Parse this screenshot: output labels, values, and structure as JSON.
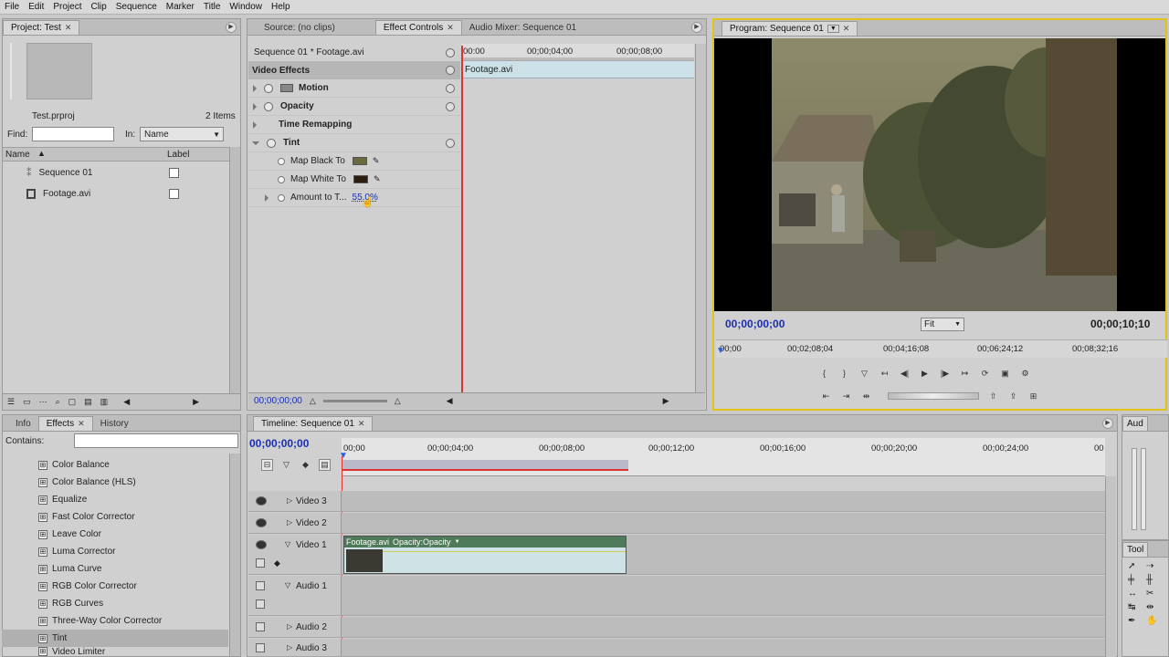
{
  "menu": [
    "File",
    "Edit",
    "Project",
    "Clip",
    "Sequence",
    "Marker",
    "Title",
    "Window",
    "Help"
  ],
  "project": {
    "tab": "Project: Test",
    "file": "Test.prproj",
    "items": "2 Items",
    "find_label": "Find:",
    "in_label": "In:",
    "in_value": "Name",
    "col_name": "Name",
    "col_label": "Label",
    "rows": [
      "Sequence 01",
      "Footage.avi"
    ]
  },
  "ec": {
    "tabs": [
      "Source: (no clips)",
      "Effect Controls",
      "Audio Mixer: Sequence 01"
    ],
    "seq": "Sequence 01 * Footage.avi",
    "video_effects": "Video Effects",
    "motion": "Motion",
    "opacity": "Opacity",
    "time_remap": "Time Remapping",
    "tint": "Tint",
    "map_black": "Map Black To",
    "map_white": "Map White To",
    "amount": "Amount to T...",
    "amount_val": "55.0%",
    "ruler": [
      "00:00",
      "00;00;04;00",
      "00;00;08;00"
    ],
    "clip": "Footage.avi",
    "timecode": "00;00;00;00",
    "black_color": "#6b6a3e",
    "white_color": "#2a1e10"
  },
  "program": {
    "tab": "Program: Sequence 01",
    "tc_left": "00;00;00;00",
    "fit": "Fit",
    "tc_right": "00;00;10;10",
    "ruler": [
      "00;00",
      "00;02;08;04",
      "00;04;16;08",
      "00;06;24;12",
      "00;08;32;16"
    ]
  },
  "effects": {
    "tabs": [
      "Info",
      "Effects",
      "History"
    ],
    "contains": "Contains:",
    "items": [
      "Color Balance",
      "Color Balance (HLS)",
      "Equalize",
      "Fast Color Corrector",
      "Leave Color",
      "Luma Corrector",
      "Luma Curve",
      "RGB Color Corrector",
      "RGB Curves",
      "Three-Way Color Corrector",
      "Tint",
      "Video Limiter"
    ]
  },
  "timeline": {
    "tab": "Timeline: Sequence 01",
    "tc": "00;00;00;00",
    "ruler": [
      "00;00",
      "00;00;04;00",
      "00;00;08;00",
      "00;00;12;00",
      "00;00;16;00",
      "00;00;20;00",
      "00;00;24;00",
      "00"
    ],
    "tracks": [
      "Video 3",
      "Video 2",
      "Video 1",
      "Audio 1",
      "Audio 2",
      "Audio 3"
    ],
    "clip": "Footage.avi",
    "clip_fx": "Opacity:Opacity"
  },
  "audio_tab": "Aud",
  "tools_tab": "Tool"
}
